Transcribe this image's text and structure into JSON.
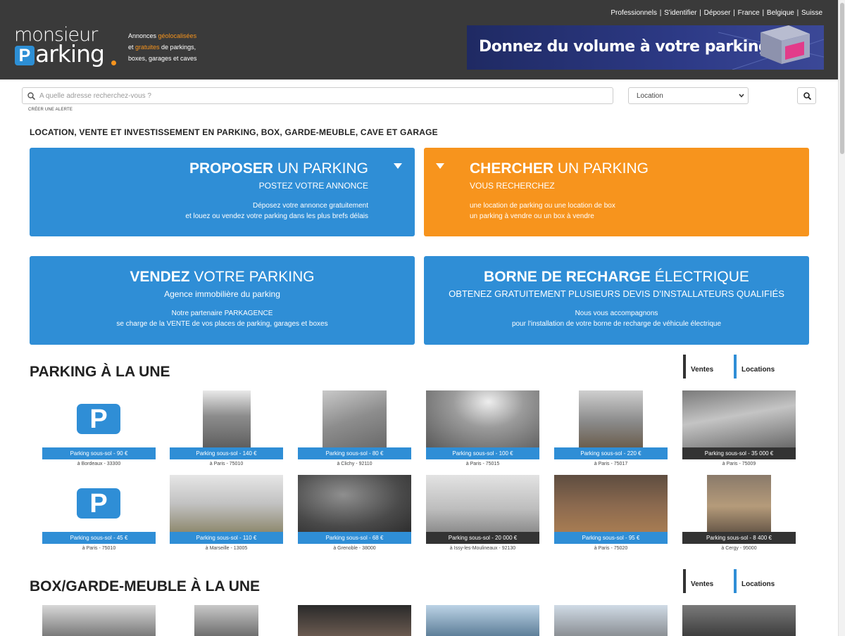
{
  "header": {
    "top_links": [
      "Professionnels",
      "S'identifier",
      "Déposer",
      "France",
      "Belgique",
      "Suisse"
    ],
    "logo_line1": "monsieur",
    "logo_p": "P",
    "logo_line2": "arking",
    "tagline": {
      "l1a": "Annonces ",
      "l1b": "géolocalisées",
      "l2a": "et ",
      "l2b": "gratuites",
      "l2c": " de parkings,",
      "l3": "boxes, garages et caves"
    },
    "banner_text": "Donnez du volume à votre parking !"
  },
  "search": {
    "placeholder": "A quelle adresse recherchez-vous ?",
    "alert_link": "CRÉER UNE ALERTE",
    "select_value": "Location"
  },
  "page_title": "LOCATION, VENTE ET INVESTISSEMENT EN PARKING, BOX, GARDE-MEUBLE, CAVE ET GARAGE",
  "boxes": {
    "propose": {
      "bold": "PROPOSER",
      "rest": " UN PARKING",
      "sub": "POSTEZ VOTRE ANNONCE",
      "line1": "Déposez votre annonce gratuitement",
      "line2": "et louez ou vendez votre parking dans les plus brefs délais"
    },
    "search": {
      "bold": "CHERCHER",
      "rest": " UN PARKING",
      "sub": "VOUS RECHERCHEZ",
      "line1": "une location de parking ou une location de box",
      "line2": "un parking à vendre ou un box à vendre"
    },
    "sell": {
      "bold": "VENDEZ",
      "rest": " VOTRE PARKING",
      "sub": "Agence immobilière du parking",
      "line1": "Notre partenaire PARKAGENCE",
      "line2": "se charge de la VENTE de vos places de parking, garages et boxes"
    },
    "charge": {
      "bold": "BORNE DE RECHARGE",
      "rest": " ÉLECTRIQUE",
      "sub": "OBTENEZ GRATUITEMENT PLUSIEURS DEVIS D'INSTALLATEURS QUALIFIÉS",
      "line1": "Nous vous accompagnons",
      "line2": "pour l'installation de votre borne de recharge de véhicule électrique"
    }
  },
  "section1": {
    "bold": "PARKING",
    "rest": " À LA UNE",
    "tab_sales": "Ventes",
    "tab_rentals": "Locations",
    "cards": [
      {
        "label": "Parking sous-sol - 90 €",
        "location": "à Bordeaux - 33300",
        "kind": "rent"
      },
      {
        "label": "Parking sous-sol - 140 €",
        "location": "à Paris - 75010",
        "kind": "rent"
      },
      {
        "label": "Parking sous-sol - 80 €",
        "location": "à Clichy - 92110",
        "kind": "rent"
      },
      {
        "label": "Parking sous-sol - 100 €",
        "location": "à Paris - 75015",
        "kind": "rent"
      },
      {
        "label": "Parking sous-sol - 220 €",
        "location": "à Paris - 75017",
        "kind": "rent"
      },
      {
        "label": "Parking sous-sol - 35 000 €",
        "location": "à Paris - 75009",
        "kind": "sale"
      },
      {
        "label": "Parking sous-sol - 45 €",
        "location": "à Paris - 75010",
        "kind": "rent"
      },
      {
        "label": "Parking sous-sol - 110 €",
        "location": "à Marseille - 13005",
        "kind": "rent"
      },
      {
        "label": "Parking sous-sol - 68 €",
        "location": "à Grenoble - 38000",
        "kind": "rent"
      },
      {
        "label": "Parking sous-sol - 20 000 €",
        "location": "à Issy-les-Moulineaux - 92130",
        "kind": "sale"
      },
      {
        "label": "Parking sous-sol - 95 €",
        "location": "à Paris - 75020",
        "kind": "rent"
      },
      {
        "label": "Parking sous-sol - 8 400 €",
        "location": "à Cergy - 95000",
        "kind": "sale"
      }
    ]
  },
  "section2": {
    "bold": "BOX/GARDE-MEUBLE",
    "rest": " À LA UNE",
    "tab_sales": "Ventes",
    "tab_rentals": "Locations"
  },
  "colors": {
    "blue": "#2f8ed6",
    "orange": "#f7941d",
    "header": "#3a3a3a",
    "dark_label": "#333333"
  }
}
